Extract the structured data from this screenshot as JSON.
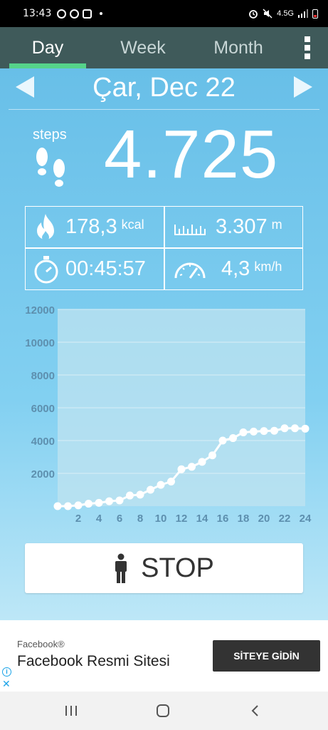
{
  "status_bar": {
    "time": "13:43",
    "network": "4.5G"
  },
  "tabs": [
    {
      "label": "Day",
      "active": true
    },
    {
      "label": "Week",
      "active": false
    },
    {
      "label": "Month",
      "active": false
    }
  ],
  "date": {
    "label": "Çar, Dec 22"
  },
  "steps": {
    "label": "steps",
    "value": "4.725"
  },
  "stats": {
    "calories": {
      "value": "178,3",
      "unit": "kcal"
    },
    "distance": {
      "value": "3.307",
      "unit": "m"
    },
    "duration": {
      "value": "00:45:57"
    },
    "speed": {
      "value": "4,3",
      "unit": "km/h"
    }
  },
  "chart_data": {
    "type": "line",
    "title": "",
    "xlabel": "",
    "ylabel": "",
    "x": [
      0,
      1,
      2,
      3,
      4,
      5,
      6,
      7,
      8,
      9,
      10,
      11,
      12,
      13,
      14,
      15,
      16,
      17,
      18,
      19,
      20,
      21,
      22,
      23,
      24
    ],
    "x_tick_labels": [
      "2",
      "4",
      "6",
      "8",
      "10",
      "12",
      "14",
      "16",
      "18",
      "20",
      "22",
      "24"
    ],
    "y_tick_labels": [
      "2000",
      "4000",
      "6000",
      "8000",
      "10000",
      "12000"
    ],
    "series": [
      {
        "values": [
          0,
          0,
          50,
          150,
          200,
          300,
          350,
          650,
          700,
          1000,
          1300,
          1500,
          2250,
          2400,
          2700,
          3100,
          4000,
          4150,
          4500,
          4550,
          4580,
          4600,
          4750,
          4750,
          4725
        ]
      }
    ],
    "xlim": [
      0,
      24
    ],
    "ylim": [
      0,
      12000
    ],
    "grid": true,
    "colors": {
      "line": "#ffffff",
      "plot_bg": "#bfe3f0",
      "tick_text": "#5d8fae"
    }
  },
  "stop_button": {
    "label": "STOP"
  },
  "ad": {
    "brand": "Facebook®",
    "headline": "Facebook Resmi Sitesi",
    "cta": "SİTEYE GİDİN"
  },
  "colors": {
    "tab_bar": "#3f5a5a",
    "tab_indicator": "#55d38a",
    "accent_sky": "#72c6ec"
  }
}
